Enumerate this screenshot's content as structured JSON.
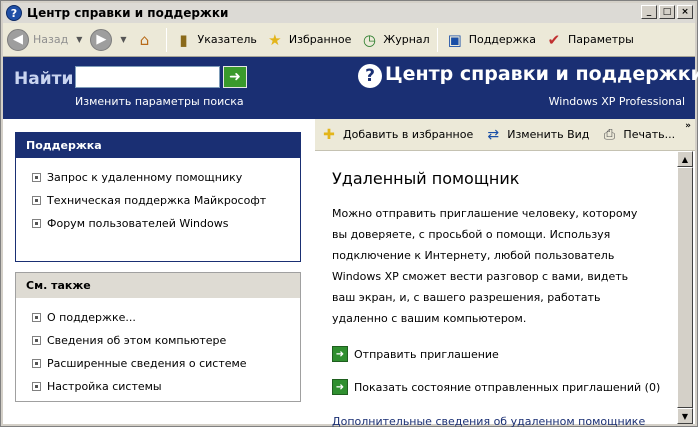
{
  "window": {
    "title": "Центр справки и поддержки",
    "controls": {
      "minimize": "_",
      "maximize": "□",
      "close": "×"
    }
  },
  "toolbar": {
    "back": "Назад",
    "index": "Указатель",
    "favorites": "Избранное",
    "history": "Журнал",
    "support": "Поддержка",
    "options": "Параметры"
  },
  "banner": {
    "find_label": "Найти",
    "search_value": "",
    "search_options": "Изменить параметры поиска",
    "help_icon": "?",
    "center_title": "Центр справки и поддержки",
    "edition": "Windows XP Professional",
    "go_arrow": "➜"
  },
  "support_panel": {
    "heading": "Поддержка",
    "items": [
      {
        "label": "Запрос к удаленному помощнику"
      },
      {
        "label": "Техническая поддержка Майкрософт"
      },
      {
        "label": "Форум пользователей Windows"
      }
    ]
  },
  "see_also_panel": {
    "heading": "См. также",
    "items": [
      {
        "label": "О поддержке..."
      },
      {
        "label": "Сведения об этом компьютере"
      },
      {
        "label": "Расширенные сведения о системе"
      },
      {
        "label": "Настройка системы"
      }
    ]
  },
  "content_toolbar": {
    "add_favorites": "Добавить в избранное",
    "change_view": "Изменить Вид",
    "print": "Печать...",
    "more": "»"
  },
  "document": {
    "heading": "Удаленный помощник",
    "body": "Можно отправить приглашение человеку, которому вы доверяете, с просьбой о помощи. Используя подключение к Интернету, любой пользователь Windows XP сможет вести разговор с вами, видеть ваш экран, и, с вашего разрешения, работать удаленно с вашим компьютером.",
    "actions": [
      {
        "label": "Отправить приглашение"
      },
      {
        "label": "Показать состояние отправленных приглашений (0)"
      }
    ],
    "more_info": "Дополнительные сведения об удаленном помощнике"
  },
  "colors": {
    "navy": "#1a2f73",
    "green": "#2f8f2f",
    "toolbar_bg": "#ece9d8"
  }
}
